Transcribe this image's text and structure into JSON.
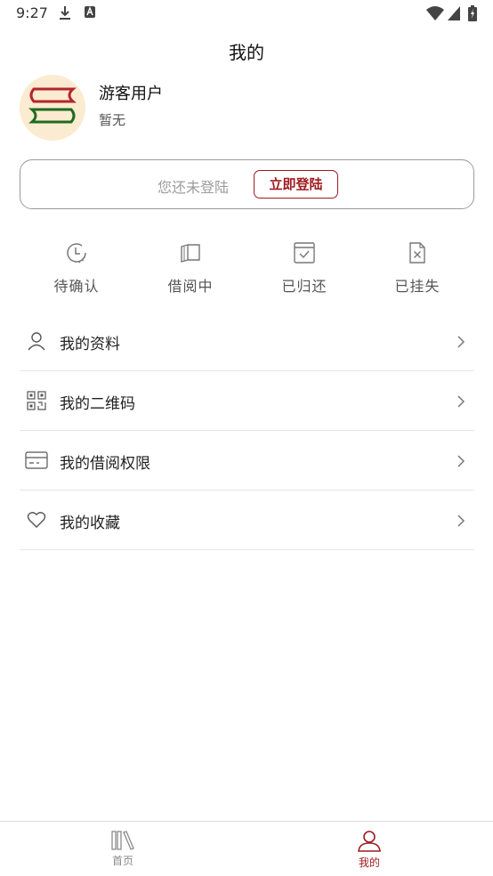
{
  "status_bar": {
    "time": "9:27",
    "icons": [
      "download-icon",
      "a-badge-icon",
      "wifi-icon",
      "signal-icon",
      "battery-icon"
    ]
  },
  "header": {
    "title": "我的"
  },
  "profile": {
    "name": "游客用户",
    "subtitle": "暂无",
    "avatar_icon": "books-icon",
    "avatar_bg": "#fbebd0"
  },
  "login": {
    "hint": "您还未登陆",
    "button_label": "立即登陆",
    "accent": "#9e1a1f"
  },
  "shortcuts": [
    {
      "label": "待确认",
      "icon": "clock-icon"
    },
    {
      "label": "借阅中",
      "icon": "open-book-icon"
    },
    {
      "label": "已归还",
      "icon": "calendar-check-icon"
    },
    {
      "label": "已挂失",
      "icon": "document-x-icon"
    }
  ],
  "menu": [
    {
      "label": "我的资料",
      "icon": "person-icon"
    },
    {
      "label": "我的二维码",
      "icon": "qrcode-icon"
    },
    {
      "label": "我的借阅权限",
      "icon": "card-icon"
    },
    {
      "label": "我的收藏",
      "icon": "heart-icon"
    }
  ],
  "bottom_nav": {
    "items": [
      {
        "label": "首页",
        "icon": "library-icon",
        "active": false
      },
      {
        "label": "我的",
        "icon": "person-icon",
        "active": true
      }
    ],
    "active_color": "#9e1a1f",
    "inactive_color": "#8a8a8a"
  }
}
